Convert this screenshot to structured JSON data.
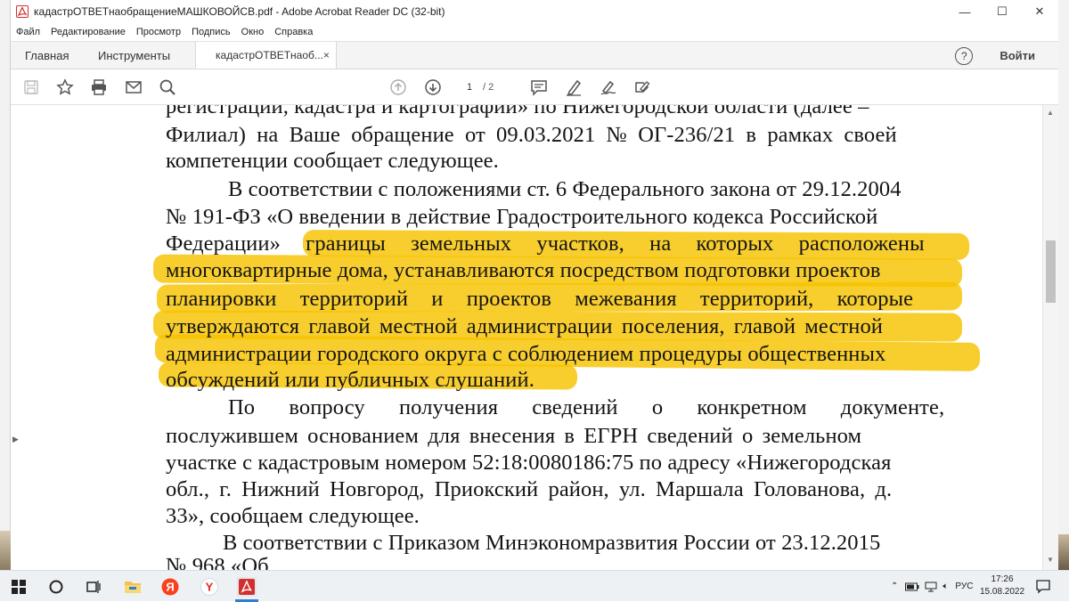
{
  "window": {
    "title": "кадастрОТВЕТнаобращениеМАШКОВОЙСВ.pdf - Adobe Acrobat Reader DC (32-bit)",
    "minimize": "—",
    "maximize": "☐",
    "close": "✕"
  },
  "menu": [
    "Файл",
    "Редактирование",
    "Просмотр",
    "Подпись",
    "Окно",
    "Справка"
  ],
  "tabs": {
    "home": "Главная",
    "tools": "Инструменты",
    "document": "кадастрОТВЕТнаоб...",
    "document_close": "×",
    "help": "?",
    "sign_in": "Войти"
  },
  "toolbar": {
    "icons": [
      "save-icon",
      "bookmark-star-icon",
      "print-icon",
      "email-icon",
      "search-icon",
      "page-up-icon",
      "page-down-icon",
      "comment-icon",
      "highlight-pen-icon",
      "sign-icon",
      "fill-sign-icon"
    ],
    "current_page": "1",
    "total_pages": "/ 2"
  },
  "document": {
    "highlight_color": "#f7c300",
    "lines": [
      "регистрации, кадастра и картографии» по Нижегородской области (далее –",
      "Филиал) на Ваше обращение от 09.03.2021 № ОГ-236/21 в рамках своей",
      "компетенции сообщает следующее.",
      "В соответствии с положениями ст. 6 Федерального закона от 29.12.2004",
      "№ 191-ФЗ «О введении в действие Градостроительного кодекса Российской",
      "Федерации» границы земельных участков, на которых расположены",
      "многоквартирные дома, устанавливаются посредством подготовки проектов",
      "планировки территорий и проектов межевания территорий, которые",
      "утверждаются главой местной администрации поселения, главой местной",
      "администрации городского округа с соблюдением процедуры общественных",
      "обсуждений или публичных слушаний.",
      "По вопросу получения сведений о конкретном документе,",
      "послужившем основанием для внесения в ЕГРН сведений о земельном",
      "участке с кадастровым номером 52:18:0080186:75 по адресу «Нижегородская",
      "обл., г. Нижний Новгород, Приокский район, ул. Маршала Голованова, д.",
      "33», сообщаем следующее.",
      "В соответствии с Приказом Минэкономразвития России от 23.12.2015",
      "№ 968 «Об"
    ]
  },
  "taskbar": {
    "apps": [
      "windows-start-icon",
      "cortana-icon",
      "task-view-icon",
      "file-explorer-icon",
      "yandex-icon",
      "yandex-browser-icon",
      "acrobat-icon"
    ],
    "language": "РУС",
    "time": "17:26",
    "date": "15.08.2022"
  }
}
